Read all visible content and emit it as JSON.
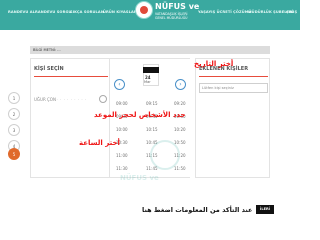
{
  "header": {
    "nav_items": [
      "RANDEVU AL",
      "RANDEVU SORGU",
      "SIKÇA SORULAN",
      "ÜRÜN KIYASLARI",
      "ÖDEME TÜRÜ",
      "YAŞAYIŞ ÜCRETİ ÇÖZÜMÜ",
      "MÜDÜRLÜK ŞUBELERİ",
      "ÇIKIŞ"
    ],
    "logo_title": "NÜFUS ve",
    "logo_sub1": "VATANDAŞLIK İŞLERİ",
    "logo_sub2": "GENEL MÜDÜRLÜĞÜ"
  },
  "info_bar": "BİLGİ METNİ: ...",
  "pagination": [
    "1",
    "2",
    "3",
    "4",
    "5"
  ],
  "active_page": "5",
  "left_panel": {
    "title": "KİŞİ SEÇİN",
    "person_name": "UĞUR ÇON",
    "person_masked": "· · · · · · · · · ·"
  },
  "date": {
    "day": "24",
    "month": "Mar",
    "label": "Perş."
  },
  "times": {
    "col1": [
      "09:00",
      "09:30",
      "10:00",
      "10:30",
      "11:00",
      "11:30",
      "12:00"
    ],
    "col2": [
      "09:15",
      "09:45",
      "10:15",
      "10:45",
      "11:15",
      "11:45",
      "12:15"
    ],
    "col3": [
      "09:20",
      "09:50",
      "10:20",
      "10:50",
      "11:20",
      "11:50",
      "12:20"
    ]
  },
  "right_panel": {
    "title": "EKLENEN KİŞİLER",
    "added_text": "Lütfen kişi seçiniz"
  },
  "annotations": {
    "date": "أختر التاريخ",
    "people": "حدد الأشخاص لحجز الموعد",
    "time": "أختر الساعة",
    "confirm": "عند التأكد من المعلومات اضغط هنا"
  },
  "submit_label": "İLERİ",
  "colors": {
    "header": "#3aa9a0",
    "accent_red": "#e74c3c",
    "active_page": "#e06a2c"
  }
}
